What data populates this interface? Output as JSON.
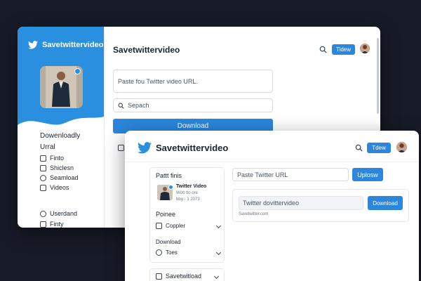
{
  "colors": {
    "accent": "#2b86dc",
    "sidebar_blue": "#2b8fe0",
    "backdrop": "#171b27"
  },
  "back_window": {
    "brand": "Savetwittervideo",
    "header_title": "Savetwittervideo",
    "header_button": "Tidew",
    "url_input_placeholder": "Paste fou Twitter video URL.",
    "search_placeholder": "Sepach",
    "download_button": "Download",
    "sidebar": {
      "heading": "Dowenloadly",
      "subheading": "Urral",
      "items": [
        {
          "label": "Finto",
          "icon": "file-icon"
        },
        {
          "label": "Shiclesn",
          "icon": "grid-icon"
        },
        {
          "label": "Seamload",
          "icon": "speech-bubble-icon"
        },
        {
          "label": "Videos",
          "icon": "video-icon"
        }
      ],
      "footer_items": [
        {
          "label": "Userdand",
          "icon": "user-icon"
        },
        {
          "label": "Finty",
          "icon": "edit-icon"
        }
      ]
    }
  },
  "front_window": {
    "brand": "Savetwittervideo",
    "header_button": "Tdew",
    "left_panel": {
      "title": "Pattt finis",
      "profile_name": "Twitter Video",
      "profile_line1": "Wott tto ore",
      "profile_line2": "bbg - 1 2073",
      "section_title": "Poinee",
      "select1": "Coppler",
      "download_label": "Download",
      "select2": "Toes",
      "bottom_select": "Savetwitload"
    },
    "url_input": "Paste Twitter URL",
    "upload_button": "Uplosw",
    "result": {
      "title": "Twitter dovittervideo",
      "download_button": "Download",
      "source": "Savetwitter.com"
    }
  }
}
